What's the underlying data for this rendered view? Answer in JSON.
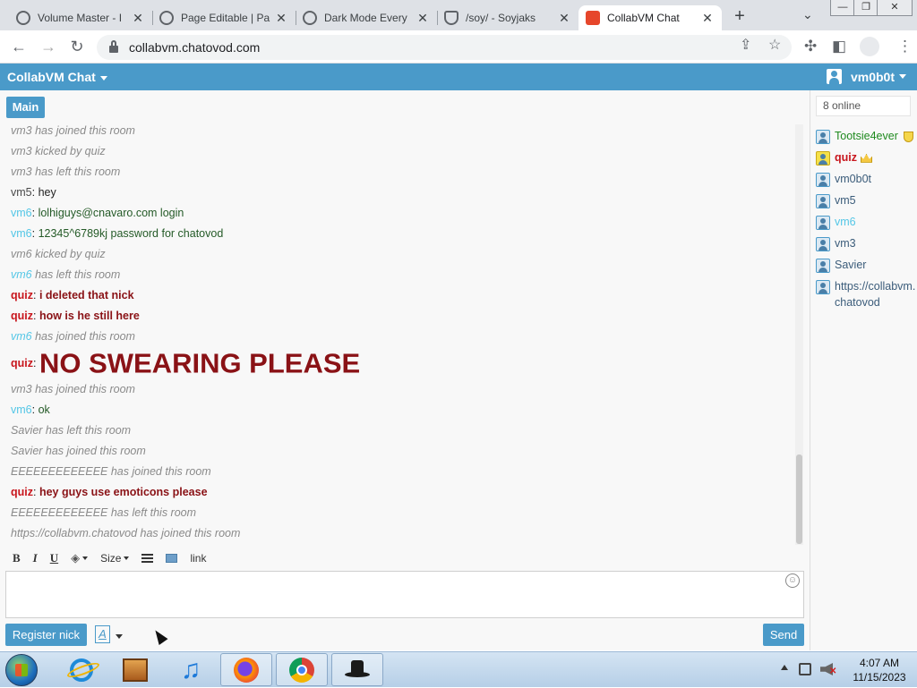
{
  "browser": {
    "tabs": [
      {
        "title": "Volume Master - I",
        "active": false
      },
      {
        "title": "Page Editable | Pa",
        "active": false
      },
      {
        "title": "Dark Mode Every",
        "active": false
      },
      {
        "title": "/soy/ - Soyjaks",
        "active": false
      },
      {
        "title": "CollabVM Chat",
        "active": true
      }
    ],
    "url": "collabvm.chatovod.com",
    "window_buttons": [
      "—",
      "❐",
      "✕"
    ]
  },
  "app": {
    "title": "CollabVM Chat",
    "current_user": "vm0b0t",
    "room_tab": "Main",
    "accent_color": "#4a9ac9"
  },
  "messages": [
    {
      "type": "system",
      "nick": "",
      "text": "vm3 has joined this room"
    },
    {
      "type": "system",
      "nick": "",
      "text": "vm3 kicked by quiz"
    },
    {
      "type": "system",
      "nick": "",
      "text": "vm3 has left this room"
    },
    {
      "type": "chat",
      "nick": "vm5",
      "text": "hey"
    },
    {
      "type": "chat",
      "nick": "vm6",
      "text": "lolhiguys@cnavaro.com login"
    },
    {
      "type": "chat",
      "nick": "vm6",
      "text": "12345^6789kj password for chatovod"
    },
    {
      "type": "system",
      "nick": "",
      "text": "vm6 kicked by quiz"
    },
    {
      "type": "system",
      "nick": "vm6",
      "text": "has left this room"
    },
    {
      "type": "chat",
      "nick": "quiz",
      "text": "i deleted that nick"
    },
    {
      "type": "chat",
      "nick": "quiz",
      "text": "how is he still here"
    },
    {
      "type": "system",
      "nick": "vm6",
      "text": "has joined this room"
    },
    {
      "type": "chat-big",
      "nick": "quiz",
      "text": "NO SWEARING PLEASE"
    },
    {
      "type": "system",
      "nick": "",
      "text": "vm3 has joined this room"
    },
    {
      "type": "chat",
      "nick": "vm6",
      "text": "ok"
    },
    {
      "type": "system",
      "nick": "",
      "text": "Savier has left this room"
    },
    {
      "type": "system",
      "nick": "",
      "text": "Savier has joined this room"
    },
    {
      "type": "system",
      "nick": "",
      "text": "EEEEEEEEEEEEE has joined this room"
    },
    {
      "type": "chat",
      "nick": "quiz",
      "text": "hey guys use emoticons please"
    },
    {
      "type": "system",
      "nick": "",
      "text": "EEEEEEEEEEEEE has left this room"
    },
    {
      "type": "system",
      "nick": "",
      "text": "https://collabvm.chatovod has joined this room"
    }
  ],
  "toolbar": {
    "bold": "B",
    "italic": "I",
    "underline": "U",
    "size": "Size",
    "link": "link"
  },
  "composer": {
    "value": "",
    "register_label": "Register nick",
    "format_label": "A",
    "send_label": "Send"
  },
  "users": {
    "online": "8 online",
    "list": [
      {
        "name": "Tootsie4ever",
        "style": "green",
        "badge": "shield",
        "icon": "user"
      },
      {
        "name": "quiz",
        "style": "red",
        "badge": "crown",
        "icon": "admin"
      },
      {
        "name": "vm0b0t",
        "style": "blue",
        "badge": "",
        "icon": "user"
      },
      {
        "name": "vm5",
        "style": "blue",
        "badge": "",
        "icon": "user"
      },
      {
        "name": "vm6",
        "style": "cyan",
        "badge": "",
        "icon": "user"
      },
      {
        "name": "vm3",
        "style": "blue",
        "badge": "",
        "icon": "user"
      },
      {
        "name": "Savier",
        "style": "blue",
        "badge": "",
        "icon": "user"
      },
      {
        "name": "https://collabvm.chatovod",
        "style": "blue",
        "badge": "",
        "icon": "user"
      }
    ]
  },
  "taskbar": {
    "apps": [
      "internet-explorer",
      "media-center",
      "music-player",
      "firefox",
      "chrome",
      "hat-app"
    ],
    "time": "4:07 AM",
    "date": "11/15/2023"
  }
}
